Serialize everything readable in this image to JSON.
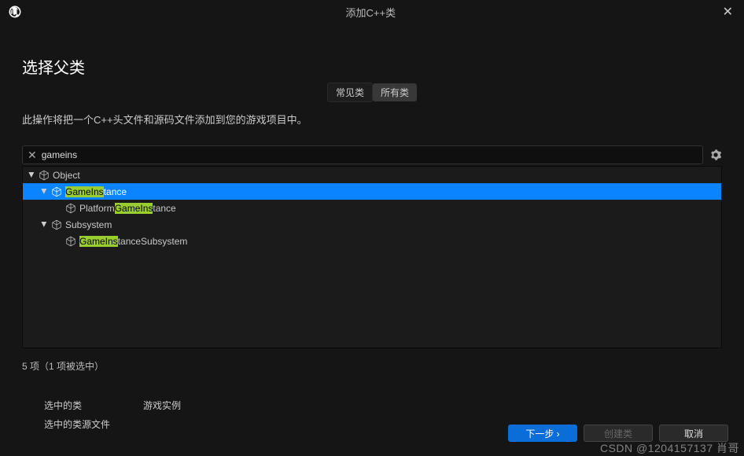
{
  "window": {
    "title": "添加C++类"
  },
  "page": {
    "heading": "选择父类",
    "tabs": {
      "common": "常见类",
      "all": "所有类"
    },
    "description": "此操作将把一个C++头文件和源码文件添加到您的游戏项目中。"
  },
  "search": {
    "value": "gameins",
    "query_hl": "GameIns"
  },
  "tree": {
    "items": [
      {
        "indent": 0,
        "arrow": true,
        "label_pre": "",
        "label_hl": "",
        "label_post": "Object",
        "selected": false
      },
      {
        "indent": 1,
        "arrow": true,
        "label_pre": "",
        "label_hl": "GameIns",
        "label_post": "tance",
        "selected": true
      },
      {
        "indent": 2,
        "arrow": false,
        "label_pre": "Platform",
        "label_hl": "GameIns",
        "label_post": "tance",
        "selected": false
      },
      {
        "indent": 1,
        "arrow": true,
        "label_pre": "",
        "label_hl": "",
        "label_post": "Subsystem",
        "selected": false
      },
      {
        "indent": 2,
        "arrow": false,
        "label_pre": "",
        "label_hl": "GameIns",
        "label_post": "tanceSubsystem",
        "selected": false
      }
    ]
  },
  "status": "5 项（1 项被选中）",
  "details": {
    "selected_class_label": "选中的类",
    "selected_class_value": "游戏实例",
    "selected_source_label": "选中的类源文件",
    "selected_source_value": ""
  },
  "buttons": {
    "next": "下一步 ›",
    "create": "创建类",
    "cancel": "取消"
  },
  "watermark": "CSDN @1204157137 肖哥"
}
